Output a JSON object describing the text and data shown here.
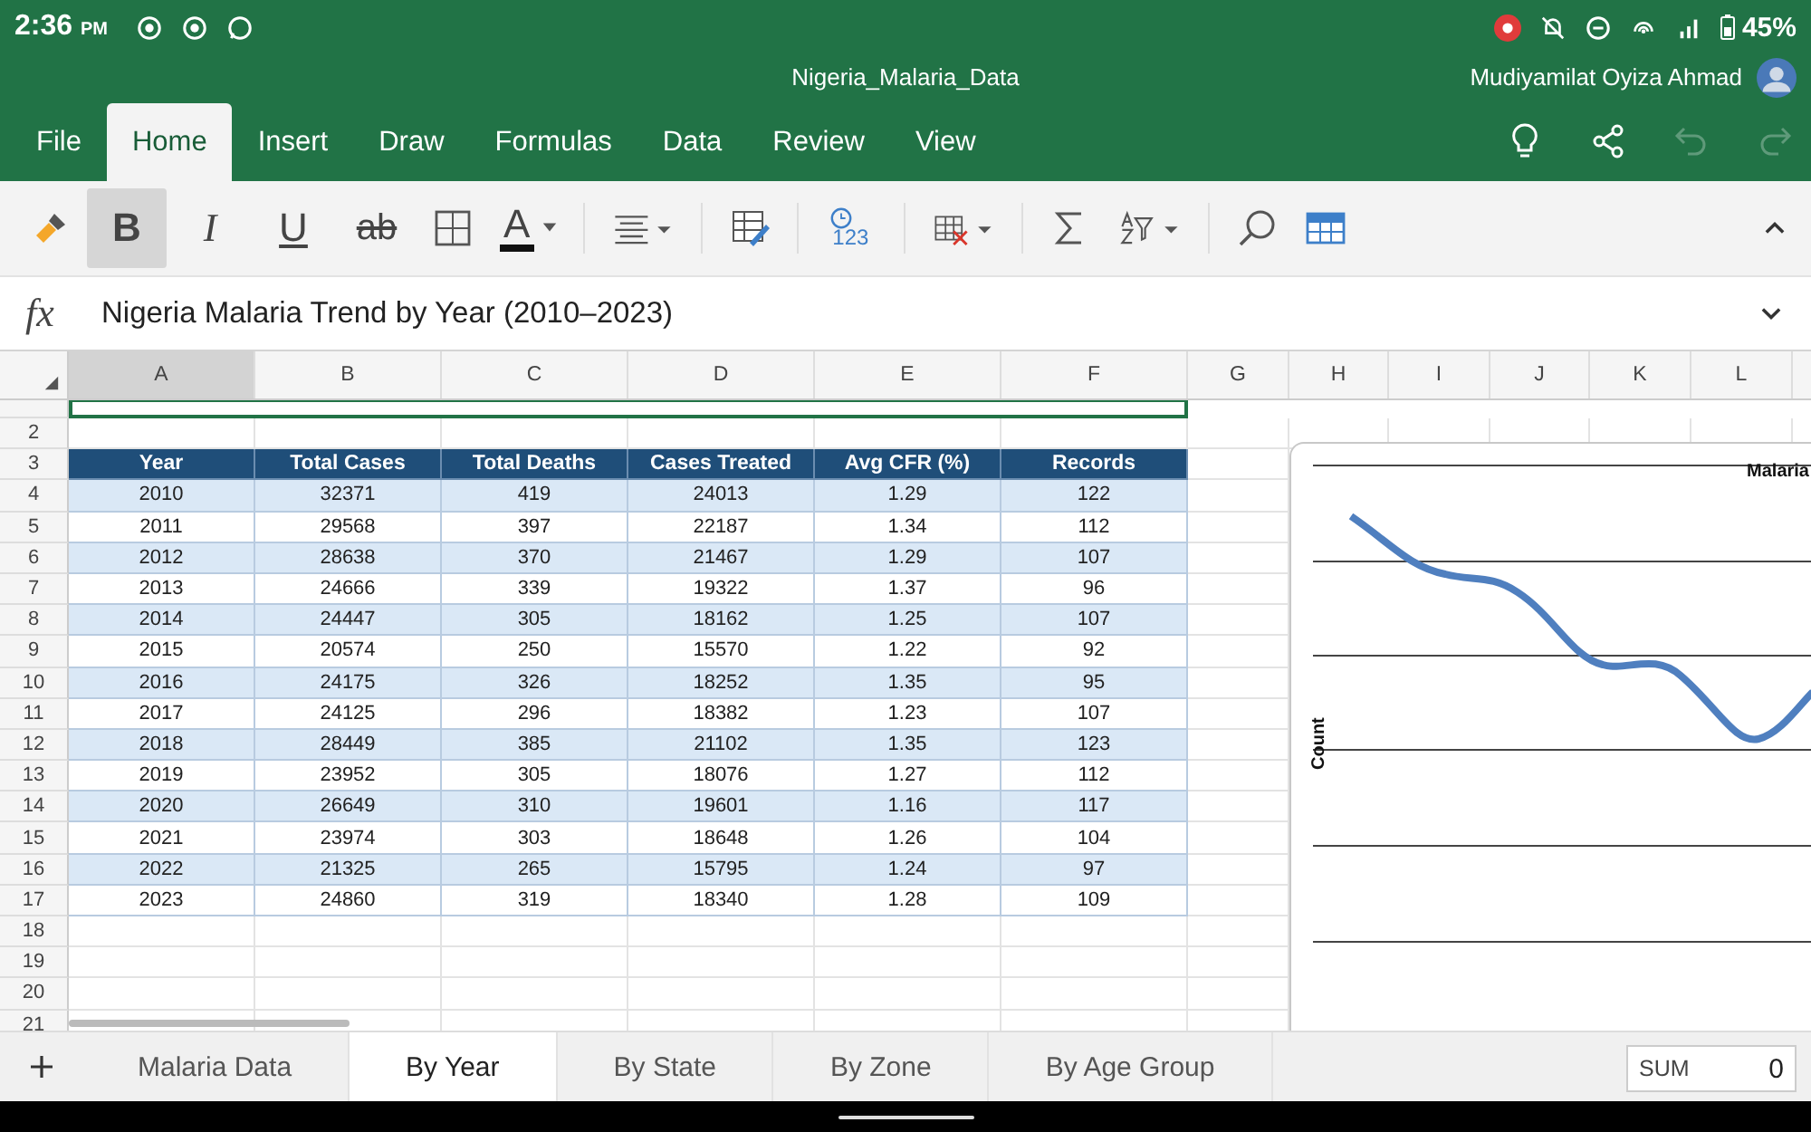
{
  "status_bar": {
    "time": "2:36",
    "period": "PM",
    "battery": "45%"
  },
  "window": {
    "title": "Nigeria_Malaria_Data",
    "user": "Mudiyamilat Oyiza Ahmad"
  },
  "ribbon_tabs": [
    {
      "label": "File",
      "selected": false
    },
    {
      "label": "Home",
      "selected": true
    },
    {
      "label": "Insert",
      "selected": false
    },
    {
      "label": "Draw",
      "selected": false
    },
    {
      "label": "Formulas",
      "selected": false
    },
    {
      "label": "Data",
      "selected": false
    },
    {
      "label": "Review",
      "selected": false
    },
    {
      "label": "View",
      "selected": false
    }
  ],
  "toolbar": {
    "format_buttons": [
      {
        "label": "B",
        "selected": true
      },
      {
        "label": "I",
        "selected": false
      },
      {
        "label": "U",
        "selected": false
      },
      {
        "label": "ab",
        "selected": false
      }
    ],
    "font_color_label": "A",
    "number_format_label": "123"
  },
  "formula_bar": {
    "label": "fx",
    "value": "Nigeria Malaria Trend by Year (2010–2023)"
  },
  "columns": [
    {
      "label": "A",
      "selected": true
    },
    {
      "label": "B",
      "selected": false
    },
    {
      "label": "C",
      "selected": false
    },
    {
      "label": "D",
      "selected": false
    },
    {
      "label": "E",
      "selected": false
    },
    {
      "label": "F",
      "selected": false
    },
    {
      "label": "G",
      "selected": false
    },
    {
      "label": "H",
      "selected": false
    },
    {
      "label": "I",
      "selected": false
    },
    {
      "label": "J",
      "selected": false
    },
    {
      "label": "K",
      "selected": false
    },
    {
      "label": "L",
      "selected": false
    }
  ],
  "table": {
    "header_row": "3",
    "columns": [
      "Year",
      "Total Cases",
      "Total Deaths",
      "Cases Treated",
      "Avg CFR (%)",
      "Records"
    ],
    "rows": [
      {
        "row": "4",
        "cells": [
          "2010",
          "32371",
          "419",
          "24013",
          "1.29",
          "122"
        ]
      },
      {
        "row": "5",
        "cells": [
          "2011",
          "29568",
          "397",
          "22187",
          "1.34",
          "112"
        ]
      },
      {
        "row": "6",
        "cells": [
          "2012",
          "28638",
          "370",
          "21467",
          "1.29",
          "107"
        ]
      },
      {
        "row": "7",
        "cells": [
          "2013",
          "24666",
          "339",
          "19322",
          "1.37",
          "96"
        ]
      },
      {
        "row": "8",
        "cells": [
          "2014",
          "24447",
          "305",
          "18162",
          "1.25",
          "107"
        ]
      },
      {
        "row": "9",
        "cells": [
          "2015",
          "20574",
          "250",
          "15570",
          "1.22",
          "92"
        ]
      },
      {
        "row": "10",
        "cells": [
          "2016",
          "24175",
          "326",
          "18252",
          "1.35",
          "95"
        ]
      },
      {
        "row": "11",
        "cells": [
          "2017",
          "24125",
          "296",
          "18382",
          "1.23",
          "107"
        ]
      },
      {
        "row": "12",
        "cells": [
          "2018",
          "28449",
          "385",
          "21102",
          "1.35",
          "123"
        ]
      },
      {
        "row": "13",
        "cells": [
          "2019",
          "23952",
          "305",
          "18076",
          "1.27",
          "112"
        ]
      },
      {
        "row": "14",
        "cells": [
          "2020",
          "26649",
          "310",
          "19601",
          "1.16",
          "117"
        ]
      },
      {
        "row": "15",
        "cells": [
          "2021",
          "23974",
          "303",
          "18648",
          "1.26",
          "104"
        ]
      },
      {
        "row": "16",
        "cells": [
          "2022",
          "21325",
          "265",
          "15795",
          "1.24",
          "97"
        ]
      },
      {
        "row": "17",
        "cells": [
          "2023",
          "24860",
          "319",
          "18340",
          "1.28",
          "109"
        ]
      }
    ]
  },
  "row_numbers_before": [
    "2"
  ],
  "row_numbers_after": [
    "18",
    "19",
    "20",
    "21"
  ],
  "chart": {
    "title": "Malaria",
    "ylabel": "Count"
  },
  "sheet_tabs": [
    {
      "label": "Malaria Data",
      "selected": false
    },
    {
      "label": "By Year",
      "selected": true
    },
    {
      "label": "By State",
      "selected": false
    },
    {
      "label": "By Zone",
      "selected": false
    },
    {
      "label": "By Age Group",
      "selected": false
    }
  ],
  "sum": {
    "label": "SUM",
    "value": "0"
  }
}
